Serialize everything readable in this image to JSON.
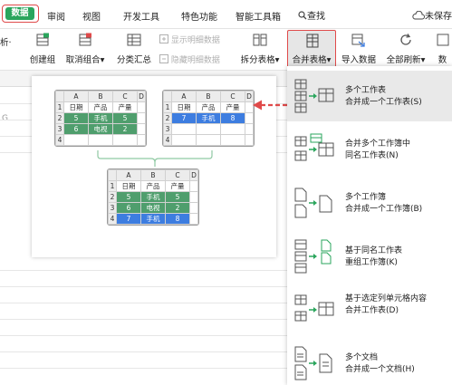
{
  "tabs": {
    "active": "数据",
    "items": [
      "审阅",
      "视图",
      "开发工具",
      "特色功能",
      "智能工具箱"
    ],
    "search": "查找",
    "save_status": "未保存"
  },
  "ribbon": {
    "cut_label": "析·",
    "create_group": "创建组",
    "ungroup": "取消组合",
    "ungroup_caret": "▾",
    "subtotal": "分类汇总",
    "show_detail": "显示明细数据",
    "hide_detail": "隐藏明细数据",
    "split_table": "拆分表格",
    "split_caret": "▾",
    "merge_table": "合并表格",
    "merge_caret": "▾",
    "import_data": "导入数据",
    "refresh_all": "全部刷新",
    "refresh_caret": "▾",
    "last_partial": "数"
  },
  "sheet": {
    "col_g": "G"
  },
  "illustration": {
    "cols": [
      "A",
      "B",
      "C",
      "D"
    ],
    "rows": [
      "1",
      "2",
      "3",
      "4"
    ],
    "table1": [
      [
        "日期",
        "产品",
        "产量",
        ""
      ],
      [
        "5",
        "手机",
        "5",
        ""
      ],
      [
        "6",
        "电视",
        "2",
        ""
      ],
      [
        "",
        "",
        "",
        ""
      ]
    ],
    "table2": [
      [
        "日期",
        "产品",
        "产量",
        ""
      ],
      [
        "7",
        "手机",
        "8",
        ""
      ],
      [
        "",
        "",
        "",
        ""
      ],
      [
        "",
        "",
        "",
        ""
      ]
    ],
    "table3": [
      [
        "日期",
        "产品",
        "产量",
        ""
      ],
      [
        "5",
        "手机",
        "5",
        ""
      ],
      [
        "6",
        "电视",
        "2",
        ""
      ],
      [
        "7",
        "手机",
        "8",
        ""
      ]
    ]
  },
  "menu": {
    "items": [
      {
        "line1": "多个工作表",
        "line2": "合并成一个工作表(S)",
        "icon": "merge-sheets-icon"
      },
      {
        "line1": "合并多个工作簿中",
        "line2": "同名工作表(N)",
        "icon": "merge-same-name-sheets-icon"
      },
      {
        "line1": "多个工作簿",
        "line2": "合并成一个工作簿(B)",
        "icon": "merge-workbooks-icon"
      },
      {
        "line1": "基于同名工作表",
        "line2": "重组工作簿(K)",
        "icon": "regroup-workbook-icon"
      },
      {
        "line1": "基于选定列单元格内容",
        "line2": "合并工作表(D)",
        "icon": "merge-by-column-icon"
      },
      {
        "line1": "多个文档",
        "line2": "合并成一个文档(H)",
        "icon": "merge-documents-icon"
      }
    ]
  },
  "colors": {
    "green": "#2aa55c",
    "red": "#e04a4a",
    "blue": "#3d7de0",
    "cell_green": "#4f9e6d"
  }
}
